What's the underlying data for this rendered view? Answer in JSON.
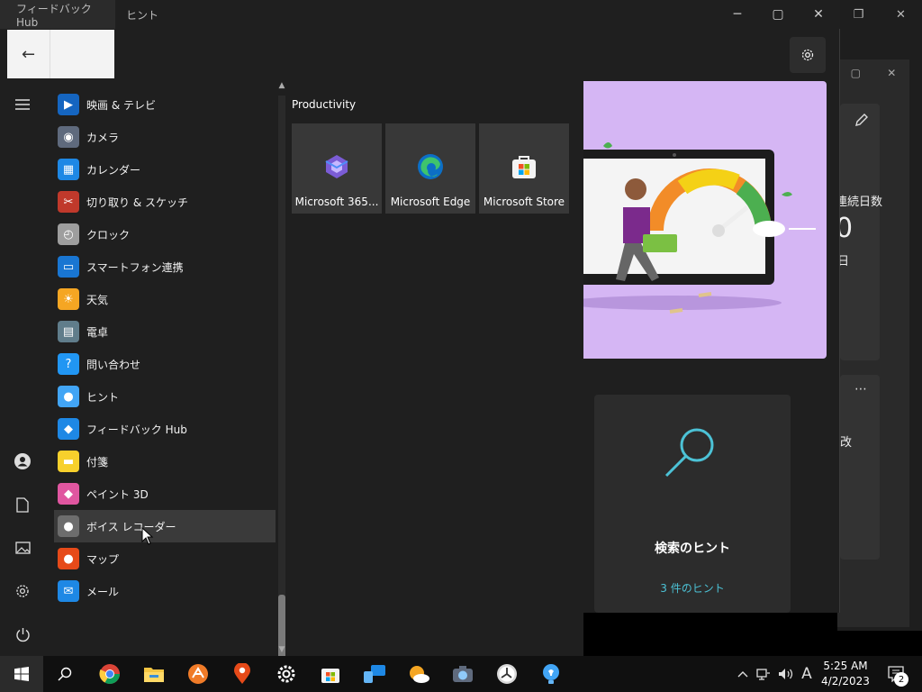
{
  "background_window": {
    "partial_text_1": "連続日数",
    "partial_number": "0",
    "partial_day": "日",
    "partial_text_2": "改",
    "more_label": "⋯"
  },
  "feedback_hub": {
    "tabs": [
      "フィードバック Hub",
      "ヒント"
    ],
    "back_label": "←",
    "tip_card": {
      "title": "検索のヒント",
      "link": "3 件のヒント"
    }
  },
  "start_menu": {
    "apps": [
      {
        "label": "映画 & テレビ",
        "icon": "movies-tv-icon",
        "color": "#1565c0"
      },
      {
        "label": "カメラ",
        "icon": "camera-icon",
        "color": "#5f6a7d"
      },
      {
        "label": "カレンダー",
        "icon": "calendar-icon",
        "color": "#1e88e5"
      },
      {
        "label": "切り取り & スケッチ",
        "icon": "snip-sketch-icon",
        "color": "#c0392b"
      },
      {
        "label": "クロック",
        "icon": "clock-icon",
        "color": "#9e9e9e"
      },
      {
        "label": "スマートフォン連携",
        "icon": "phone-link-icon",
        "color": "#1976d2"
      },
      {
        "label": "天気",
        "icon": "weather-icon",
        "color": "#f5a623"
      },
      {
        "label": "電卓",
        "icon": "calculator-icon",
        "color": "#607d8b"
      },
      {
        "label": "問い合わせ",
        "icon": "get-help-icon",
        "color": "#2196f3"
      },
      {
        "label": "ヒント",
        "icon": "tips-icon",
        "color": "#42a5f5"
      },
      {
        "label": "フィードバック Hub",
        "icon": "feedback-hub-icon",
        "color": "#1e88e5"
      },
      {
        "label": "付箋",
        "icon": "sticky-notes-icon",
        "color": "#f7d02c"
      },
      {
        "label": "ペイント 3D",
        "icon": "paint-3d-icon",
        "color": "#e056a0"
      },
      {
        "label": "ボイス レコーダー",
        "icon": "voice-recorder-icon",
        "color": "#6d6d6d"
      },
      {
        "label": "マップ",
        "icon": "maps-icon",
        "color": "#e64a19"
      },
      {
        "label": "メール",
        "icon": "mail-icon",
        "color": "#1e88e5"
      }
    ],
    "hovered_index": 13,
    "group_title": "Productivity",
    "tiles": [
      {
        "label": "Microsoft 365...",
        "icon": "microsoft-365-icon"
      },
      {
        "label": "Microsoft Edge",
        "icon": "edge-icon"
      },
      {
        "label": "Microsoft Store",
        "icon": "store-icon"
      }
    ]
  },
  "taskbar": {
    "apps": [
      "chrome-icon",
      "file-explorer-icon",
      "app-icon",
      "maps-icon",
      "settings-icon",
      "store-icon",
      "phone-link-icon",
      "weather-icon",
      "camera-icon",
      "clock-icon",
      "tips-icon"
    ],
    "ime": "A",
    "time": "5:25 AM",
    "date": "4/2/2023",
    "notification_count": "2"
  },
  "colors": {
    "accent": "#4cc2d6",
    "hero_bg": "#d5b6f4",
    "menu_bg": "#1f1f1f"
  }
}
